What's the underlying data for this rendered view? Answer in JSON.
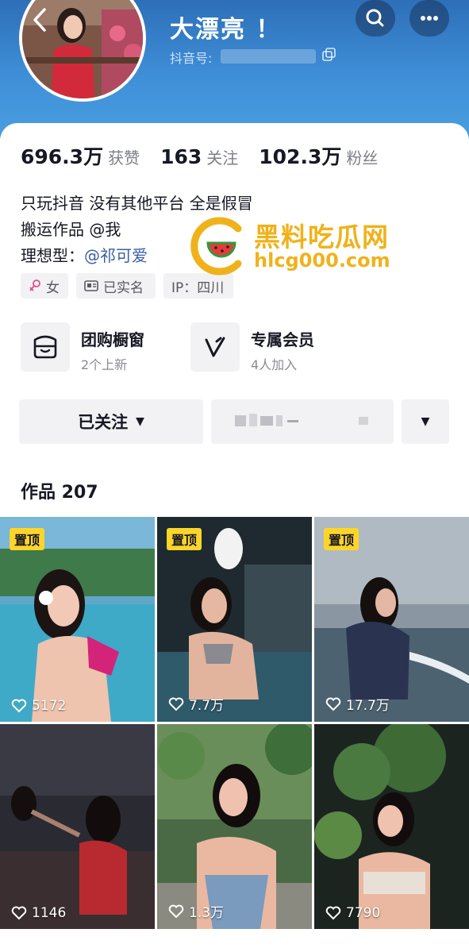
{
  "header": {
    "nickname": "大漂亮 ！",
    "douyin_id_label": "抖音号:",
    "icons": {
      "back": "back-icon",
      "search": "search-icon",
      "more": "more-icon",
      "copy": "copy-icon"
    }
  },
  "stats": [
    {
      "value": "696.3万",
      "label": "获赞"
    },
    {
      "value": "163",
      "label": "关注"
    },
    {
      "value": "102.3万",
      "label": "粉丝"
    }
  ],
  "bio": {
    "line1": "只玩抖音 没有其他平台 全是假冒",
    "line2": "搬运作品 @我",
    "line3_prefix": "理想型：",
    "line3_mention": "@祁可爱"
  },
  "tags": {
    "gender": "女",
    "verified": "已实名",
    "ip": "IP：四川"
  },
  "features": {
    "shop_title": "团购橱窗",
    "shop_sub": "2个上新",
    "member_title": "专属会员",
    "member_sub": "4人加入"
  },
  "actions": {
    "follow_label": "已关注"
  },
  "works": {
    "title": "作品 207",
    "pinned_label": "置顶",
    "items": [
      {
        "likes": "5172",
        "pinned": true
      },
      {
        "likes": "7.7万",
        "pinned": true
      },
      {
        "likes": "17.7万",
        "pinned": true
      },
      {
        "likes": "1146",
        "pinned": false
      },
      {
        "likes": "1.3万",
        "pinned": false
      },
      {
        "likes": "7790",
        "pinned": false
      }
    ]
  },
  "watermark": {
    "name": "黑料吃瓜网",
    "domain": "hlcg000.com"
  },
  "colors": {
    "header_blue": "#3f8fd8",
    "pin_yellow": "#fdd52a",
    "mention_blue": "#3b5fa4",
    "watermark_orange": "#f0b21a"
  }
}
